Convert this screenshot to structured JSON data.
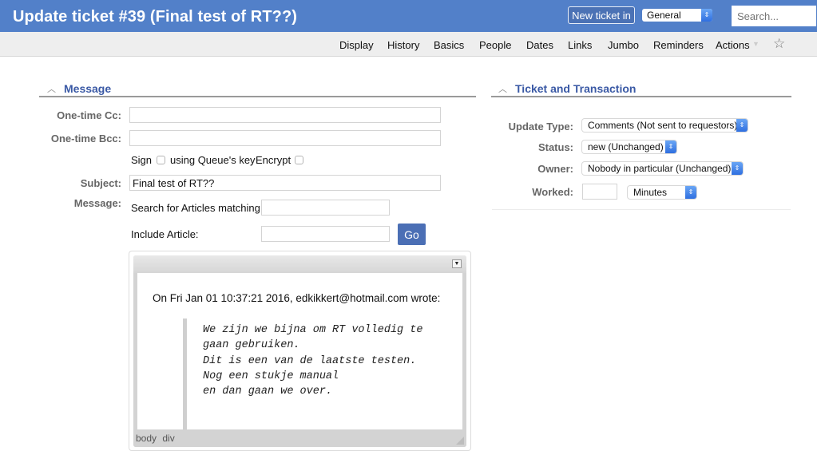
{
  "header": {
    "title": "Update ticket #39 (Final test of RT??)",
    "new_ticket_label": "New ticket in",
    "queue_selected": "General",
    "search_placeholder": "Search..."
  },
  "nav": {
    "items": [
      "Display",
      "History",
      "Basics",
      "People",
      "Dates",
      "Links",
      "Jumbo",
      "Reminders",
      "Actions"
    ],
    "caret_icon": "triangle-down-icon",
    "star_icon": "star-outline-icon"
  },
  "message_section": {
    "title": "Message",
    "chevron_icon": "chevron-up-icon",
    "cc_label": "One-time Cc:",
    "cc_value": "",
    "bcc_label": "One-time Bcc:",
    "bcc_value": "",
    "sign_label": "Sign",
    "sign_checked": false,
    "queue_key_label": "using Queue's key",
    "encrypt_label": "Encrypt",
    "encrypt_checked": false,
    "subject_label": "Subject:",
    "subject_value": "Final test of RT??",
    "message_label": "Message:",
    "search_articles_label": "Search for Articles matching",
    "search_articles_value": "",
    "include_article_label": "Include Article:",
    "include_article_value": "",
    "go_label": "Go"
  },
  "editor": {
    "toolbar_toggle_icon": "toolbar-collapse-icon",
    "quote_header": "On Fri Jan 01 10:37:21 2016, edkikkert@hotmail.com wrote:",
    "quote_lines": [
      "We zijn we bijna om RT volledig te",
      "gaan gebruiken.",
      "Dit is een van de laatste testen.",
      "Nog een stukje manual",
      "en dan gaan we over."
    ],
    "status_path": "body div"
  },
  "ticket_section": {
    "title": "Ticket and Transaction",
    "chevron_icon": "chevron-up-icon",
    "update_type_label": "Update Type:",
    "update_type_value": "Comments (Not sent to requestors)",
    "status_label": "Status:",
    "status_value": "new (Unchanged)",
    "owner_label": "Owner:",
    "owner_value": "Nobody in particular (Unchanged)",
    "worked_label": "Worked:",
    "worked_value": "",
    "worked_unit": "Minutes"
  },
  "colors": {
    "header_bg": "#5280c9",
    "section_title": "#3a59a5",
    "go_button": "#4b6fb5"
  }
}
